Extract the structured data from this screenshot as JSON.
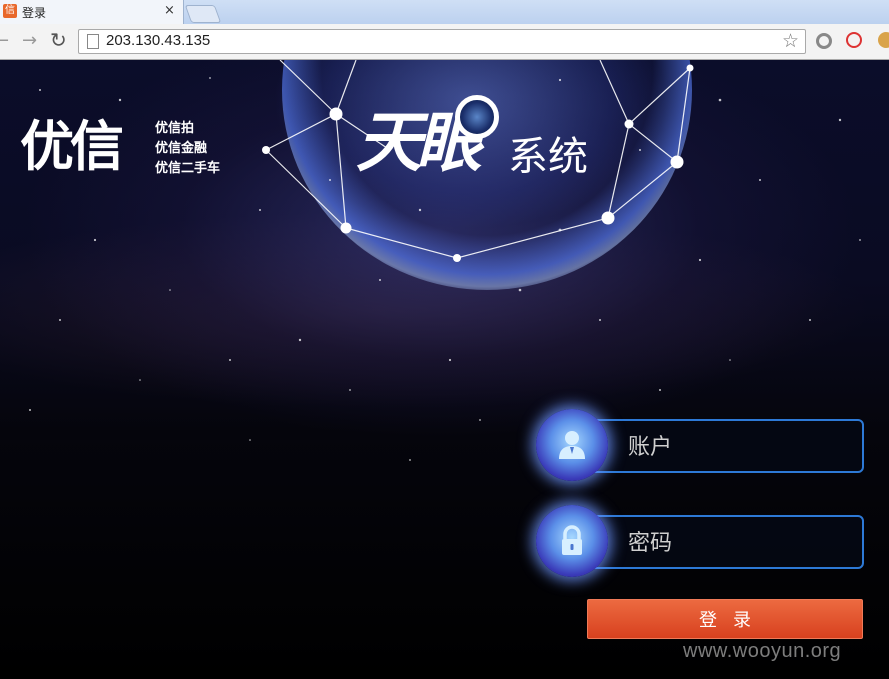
{
  "browser": {
    "tab": {
      "title": "登录",
      "favicon": "信",
      "close": "×"
    },
    "address": {
      "url": "203.130.43.135"
    },
    "icons": [
      "back-icon",
      "forward-icon",
      "reload-icon",
      "page-icon",
      "star-icon",
      "extension-icon"
    ]
  },
  "brand": {
    "logo": "优信",
    "taglines": [
      "优信拍",
      "优信金融",
      "优信二手车"
    ]
  },
  "system_logo": {
    "main": "天眼",
    "sub": "系统"
  },
  "login": {
    "account_placeholder": "账户",
    "password_placeholder": "密码",
    "submit_label": "登录"
  },
  "watermark": "www.wooyun.org",
  "colors": {
    "button_red": "#d8411f",
    "field_border": "#2d79d6"
  }
}
